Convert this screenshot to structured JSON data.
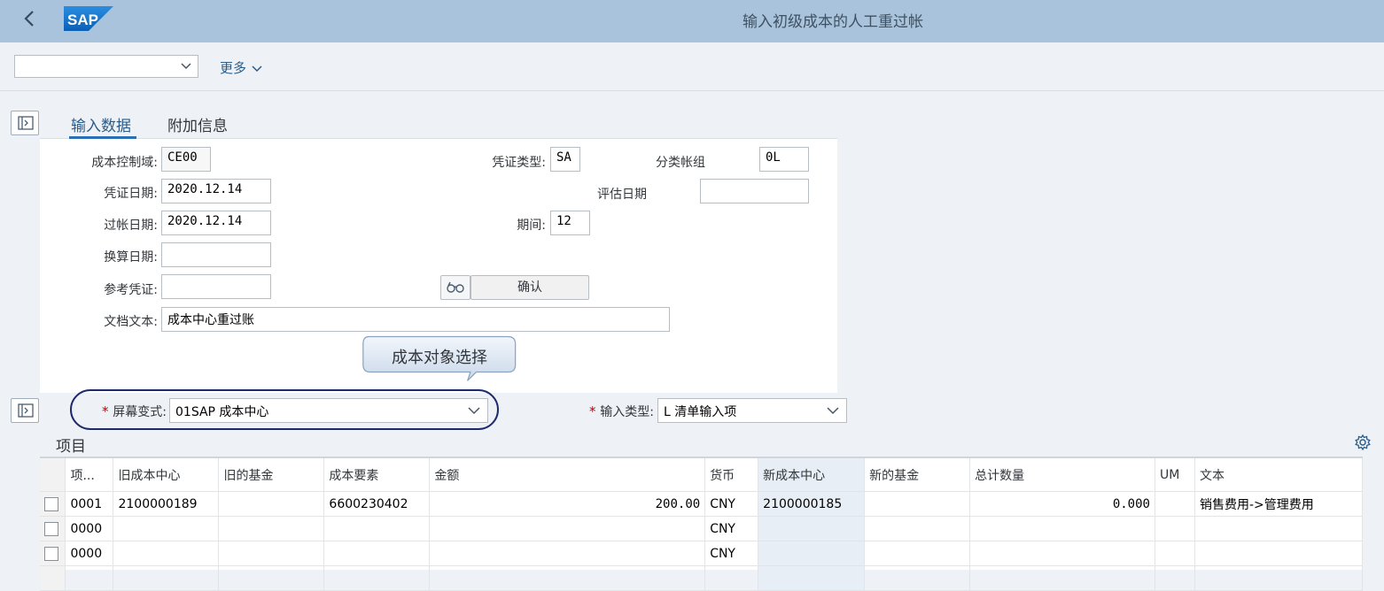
{
  "shell": {
    "title": "输入初级成本的人工重过帐",
    "logo_text": "SAP",
    "brand_color": "#1a73c8"
  },
  "toolbar": {
    "variant_value": "",
    "more_label": "更多"
  },
  "tabs": [
    {
      "label": "输入数据",
      "active": true
    },
    {
      "label": "附加信息",
      "active": false
    }
  ],
  "form": {
    "controlling_area": {
      "label": "成本控制域:",
      "value": "CE00"
    },
    "doc_type": {
      "label": "凭证类型:",
      "value": "SA"
    },
    "ledger_group": {
      "label": "分类帐组",
      "value": "0L"
    },
    "doc_date": {
      "label": "凭证日期:",
      "value": "2020.12.14"
    },
    "valuation_date": {
      "label": "评估日期",
      "value": ""
    },
    "posting_date": {
      "label": "过帐日期:",
      "value": "2020.12.14"
    },
    "period": {
      "label": "期间:",
      "value": "12"
    },
    "translation_date": {
      "label": "换算日期:",
      "value": ""
    },
    "reference_doc": {
      "label": "参考凭证:",
      "value": ""
    },
    "confirm_label": "确认",
    "doc_text": {
      "label": "文档文本:",
      "value": "成本中心重过账"
    }
  },
  "callout": {
    "text": "成本对象选择"
  },
  "screen_variant": {
    "label": "屏幕变式:",
    "value": "01SAP 成本中心"
  },
  "input_type": {
    "label": "输入类型:",
    "value": "L 清单输入项"
  },
  "items": {
    "title": "项目",
    "columns": [
      "项...",
      "旧成本中心",
      "旧的基金",
      "成本要素",
      "金额",
      "货币",
      "新成本中心",
      "新的基金",
      "总计数量",
      "UM",
      "文本"
    ],
    "rows": [
      [
        "0001",
        "2100000189",
        "",
        "6600230402",
        "200.00",
        "CNY",
        "2100000185",
        "",
        "0.000",
        "",
        "销售费用->管理费用"
      ],
      [
        "0000",
        "",
        "",
        "",
        "",
        "CNY",
        "",
        "",
        "",
        "",
        ""
      ],
      [
        "0000",
        "",
        "",
        "",
        "",
        "CNY",
        "",
        "",
        "",
        "",
        ""
      ]
    ]
  }
}
